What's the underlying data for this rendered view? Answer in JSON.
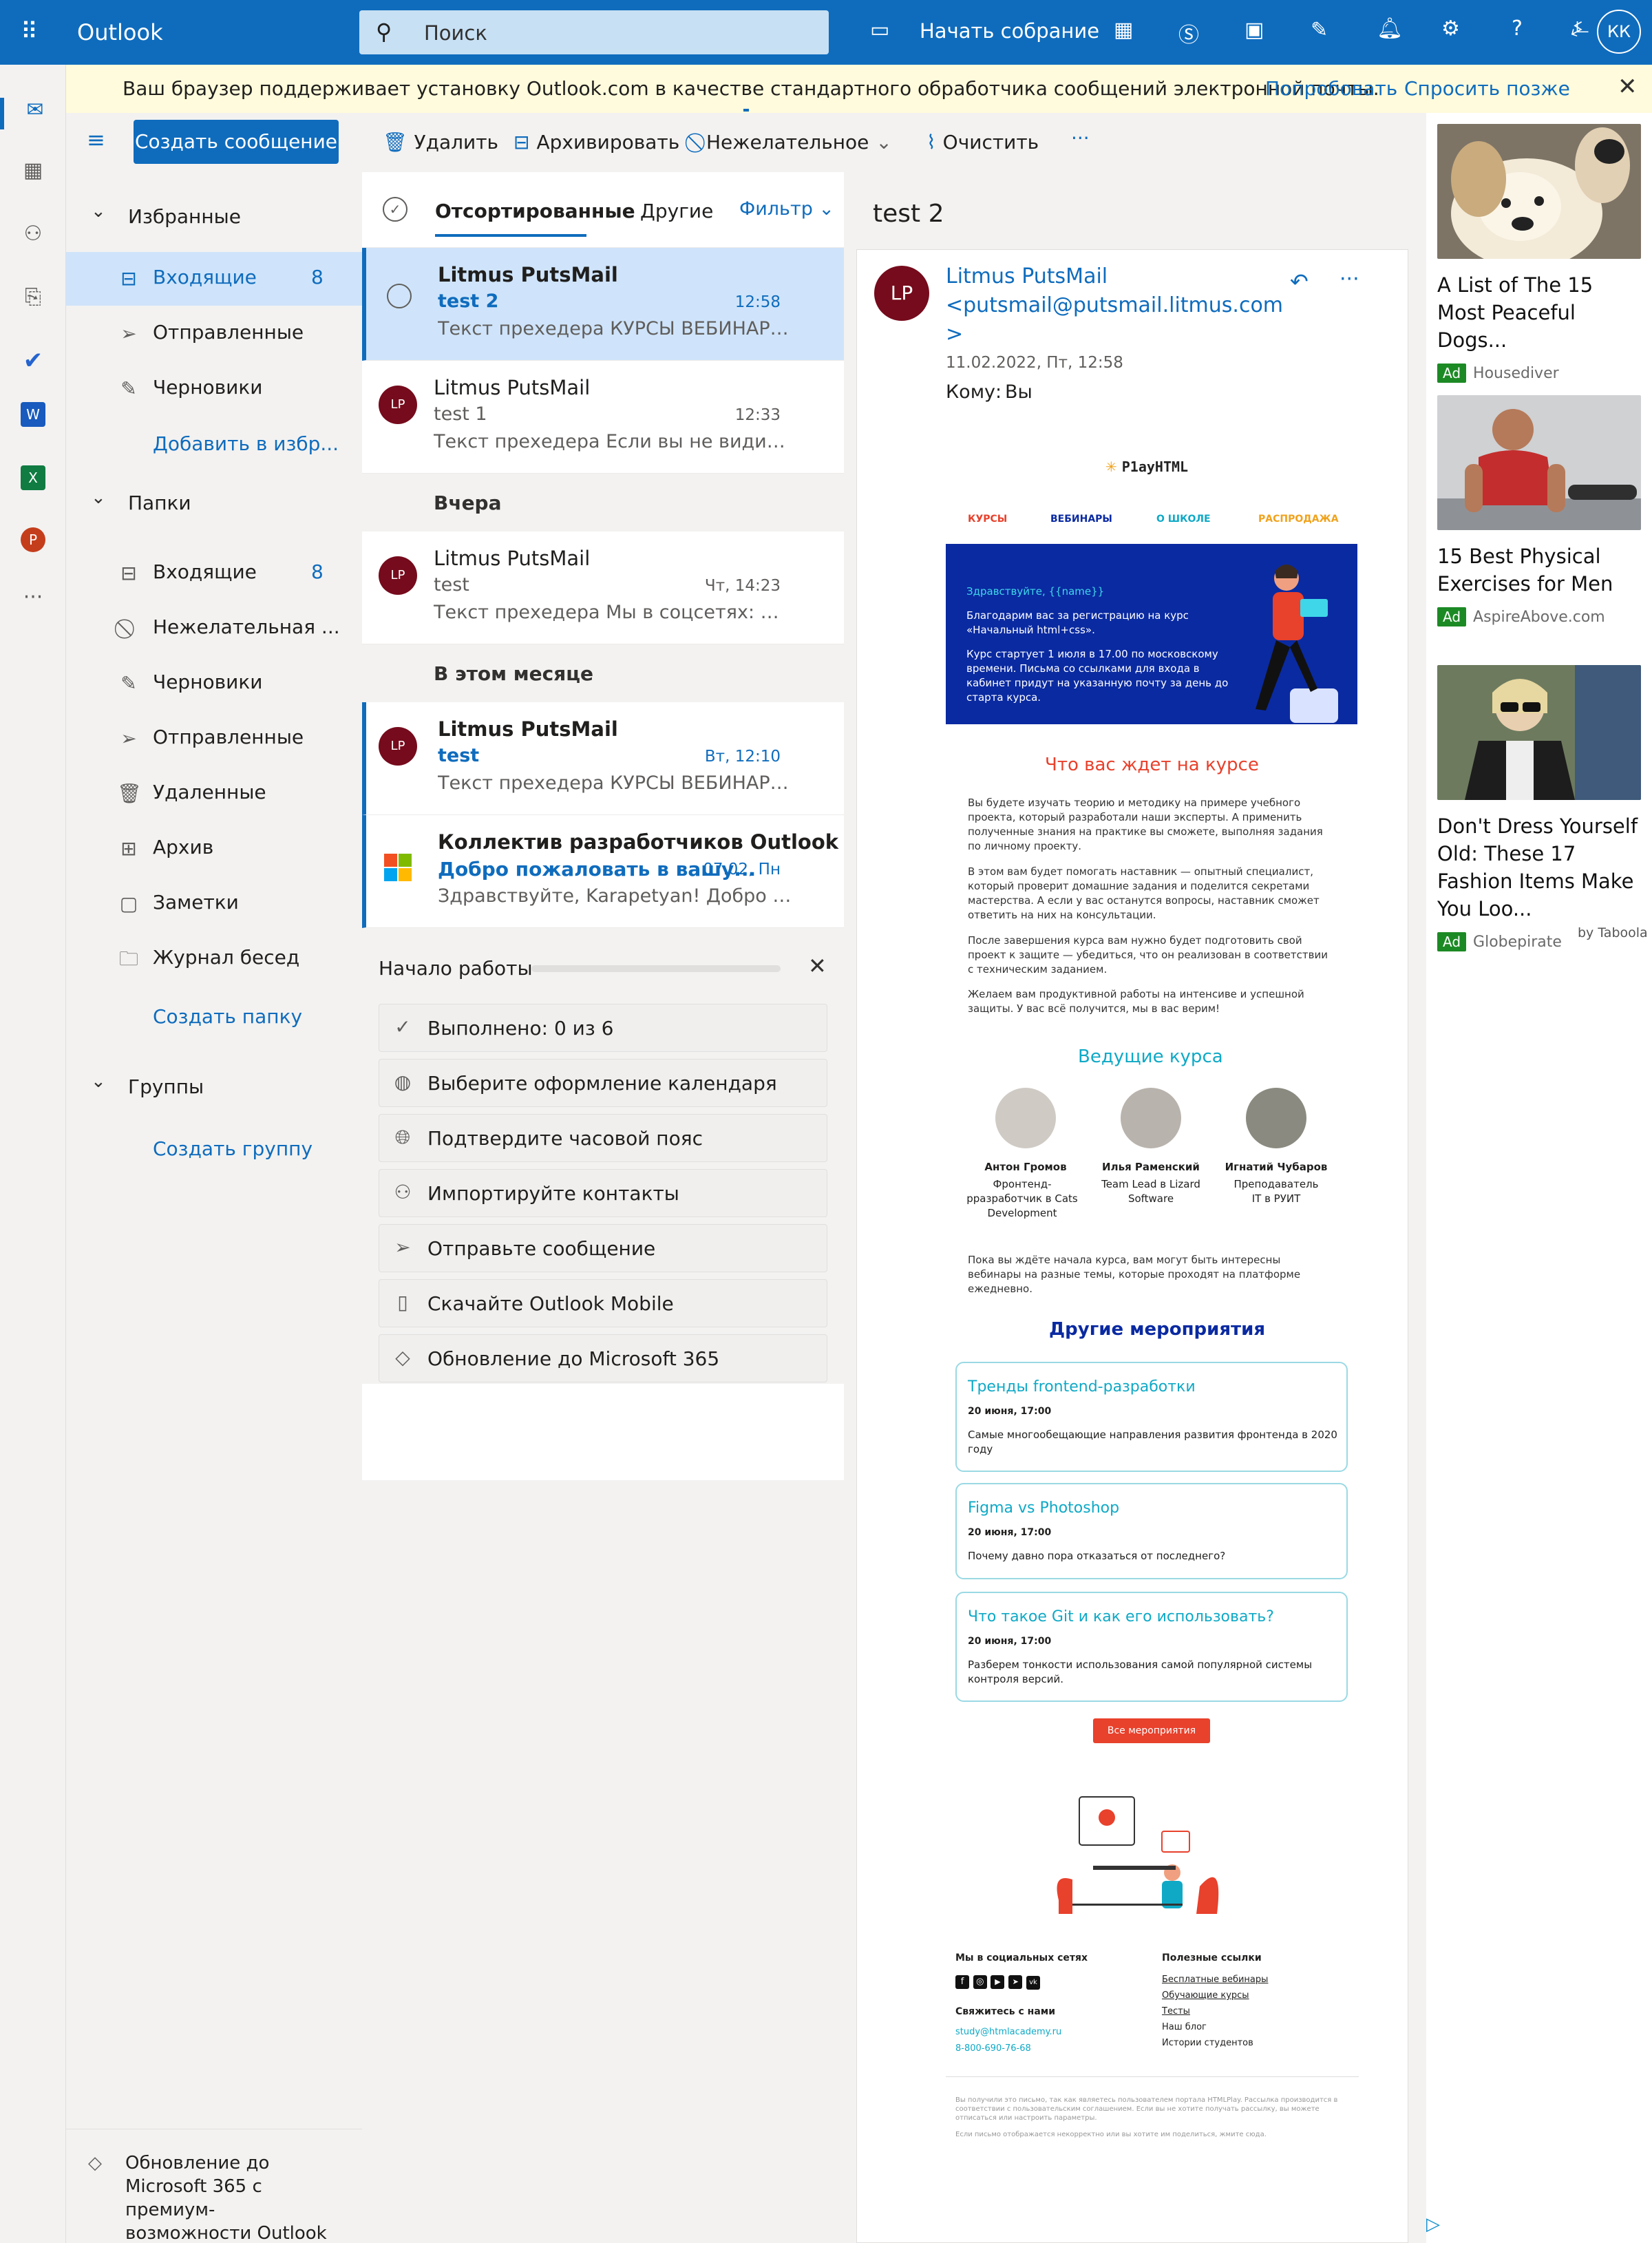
{
  "app": {
    "name": "Outlook",
    "search_placeholder": "Поиск",
    "meeting": "Начать собрание",
    "user_initials": "КК"
  },
  "banner": {
    "text": "Ваш браузер поддерживает установку Outlook.com в качестве стандартного обработчика сообщений электронной почты.",
    "try": "Попробовать",
    "later": "Спросить позже"
  },
  "compose": "Создать сообщение",
  "toolbar": {
    "delete": "Удалить",
    "archive": "Архивировать",
    "junk": "Нежелательное",
    "sweep": "Очистить",
    "more": "···"
  },
  "favorites": {
    "title": "Избранные",
    "items": [
      {
        "label": "Входящие",
        "count": "8"
      },
      {
        "label": "Отправленные"
      },
      {
        "label": "Черновики"
      }
    ],
    "add": "Добавить в избр..."
  },
  "folders": {
    "title": "Папки",
    "items": [
      {
        "label": "Входящие",
        "count": "8"
      },
      {
        "label": "Нежелательная ..."
      },
      {
        "label": "Черновики"
      },
      {
        "label": "Отправленные"
      },
      {
        "label": "Удаленные"
      },
      {
        "label": "Архив"
      },
      {
        "label": "Заметки"
      },
      {
        "label": "Журнал бесед"
      }
    ],
    "create": "Создать папку"
  },
  "groups": {
    "title": "Группы",
    "create": "Создать группу"
  },
  "upgrade": {
    "line1": "Обновление до",
    "line2": "Microsoft 365 с",
    "line3": "премиум-",
    "line4": "возможности Outlook"
  },
  "list": {
    "tabs": {
      "focused": "Отсортированные",
      "other": "Другие",
      "filter": "Фильтр"
    },
    "messages": [
      {
        "sender": "Litmus PutsMail",
        "subject": "test 2",
        "time": "12:58",
        "preview": "Текст прехедера КУРСЫ ВЕБИНАРЫ О..."
      },
      {
        "sender": "Litmus PutsMail",
        "subject": "test 1",
        "time": "12:33",
        "preview": "Текст прехедера Если вы не видите да...",
        "avatar": "LP"
      },
      {
        "sender": "Litmus PutsMail",
        "subject": "test",
        "time": "Чт, 14:23",
        "preview": "Текст прехедера Мы в соцсетях: АКЦ...",
        "avatar": "LP"
      },
      {
        "sender": "Litmus PutsMail",
        "subject": "test",
        "time": "Вт, 12:10",
        "preview": "Текст прехедера КУРСЫ ВЕБИНАРЫ О...",
        "avatar": "LP"
      },
      {
        "sender": "Коллектив разработчиков Outlook",
        "subject": "Добро пожаловать в вашу...",
        "time": "07.02, Пн",
        "preview": "Здравствуйте, Karapetyan! Добро пож..."
      }
    ],
    "groups": {
      "yesterday": "Вчера",
      "month": "В этом месяце"
    }
  },
  "getting_started": {
    "title": "Начало работы",
    "steps": [
      "Выполнено: 0 из 6",
      "Выберите оформление календаря",
      "Подтвердите часовой пояс",
      "Импортируйте контакты",
      "Отправьте сообщение",
      "Скачайте Outlook Mobile",
      "Обновление до Microsoft 365"
    ]
  },
  "reading": {
    "subject": "test 2",
    "sender_name": "Litmus PutsMail",
    "sender_email": "<putsmail@putsmail.litmus.com",
    "sender_close": ">",
    "avatar": "LP",
    "date": "11.02.2022, Пт, 12:58",
    "to_label": "Кому:",
    "to": "Вы"
  },
  "email": {
    "logo": "P1ayHTML",
    "nav": [
      "КУРСЫ",
      "ВЕБИНАРЫ",
      "О ШКОЛЕ",
      "РАСПРОДАЖА"
    ],
    "hero": {
      "hello": "Здравствуйте, {{name}}",
      "p1": "Благодарим вас за регистрацию на курс «Начальный html+css».",
      "p2": "Курс стартует 1 июля в 17.00 по московскому времени. Письма со ссылками для входа в кабинет придут на указанную почту за день до старта курса."
    },
    "what_title": "Что вас ждет на курсе",
    "paras": [
      "Вы будете изучать теорию и методику на примере учебного проекта, который разработали наши эксперты. А применить полученные знания на практике вы сможете, выполняя задания по личному проекту.",
      "В этом вам будет помогать наставник — опытный специалист, который проверит домашние задания и поделится секретами мастерства. А если у вас останутся вопросы, наставник сможет ответить на них на консультации.",
      "После завершения курса вам нужно будет подготовить свой проект к защите — убедиться, что он реализован в соответствии с техническим заданием.",
      "Желаем вам продуктивной работы на интенсиве и успешной защиты. У вас всё получится, мы в вас верим!"
    ],
    "speakers_title": "Ведущие курса",
    "speakers": [
      {
        "name": "Антон Громов",
        "role": "Фронтенд-рразработчик в Cats Development"
      },
      {
        "name": "Илья Раменский",
        "role": "Team Lead в Lizard Software"
      },
      {
        "name": "Игнатий Чубаров",
        "role": "Преподаватель IT в РУИТ"
      }
    ],
    "waiting": "Пока вы ждёте начала курса, вам могут быть интересны вебинары на разные темы, которые проходят на платформе ежедневно.",
    "events_title": "Другие мероприятия",
    "events": [
      {
        "title": "Тренды frontend-разработки",
        "date": "20 июня, 17:00",
        "text": "Самые многообещающие направления развития фронтенда в 2020 году"
      },
      {
        "title": "Figma vs Photoshop",
        "date": "20 июня, 17:00",
        "text": "Почему давно пора отказаться от последнего?"
      },
      {
        "title": "Что такое Git и как его использовать?",
        "date": "20 июня, 17:00",
        "text": "Разберем тонкости использования самой популярной системы контроля версий."
      }
    ],
    "all_events": "Все мероприятия",
    "footer": {
      "social": "Мы в социальных сетях",
      "contact": "Свяжитесь с нами",
      "email": "study@htmlacademy.ru",
      "phone": "8-800-690-76-68",
      "links_title": "Полезные ссылки",
      "links": [
        "Бесплатные вебинары",
        "Обучающие курсы",
        "Тесты",
        "Наш блог",
        "Истории студентов"
      ],
      "legal1": "Вы получили это письмо, так как являетесь пользователем портала HTMLPlay. Рассылка производится в соответствии с пользовательским соглашением. Если вы не хотите получать рассылку, вы можете отписаться или настроить параметры.",
      "legal2": "Если письмо отображается некорректно или вы хотите им поделиться, жмите сюда."
    }
  },
  "ads": [
    {
      "title": "A List of The 15 Most Peaceful Dogs...",
      "source": "Housediver"
    },
    {
      "title": "15 Best Physical Exercises for Men",
      "source": "AspireAbove.com"
    },
    {
      "title": "Don't Dress Yourself Old: These 17 Fashion Items Make You Loo...",
      "source": "Globepirate"
    }
  ],
  "ad_badge": "Ad",
  "taboola": "by Taboola",
  "colors": {
    "brand": "#0f6cbd",
    "avatar": "#750b1c",
    "accent_red": "#e8412c",
    "accent_cyan": "#0fa9c6",
    "hero_bg": "#0a2aa1"
  }
}
